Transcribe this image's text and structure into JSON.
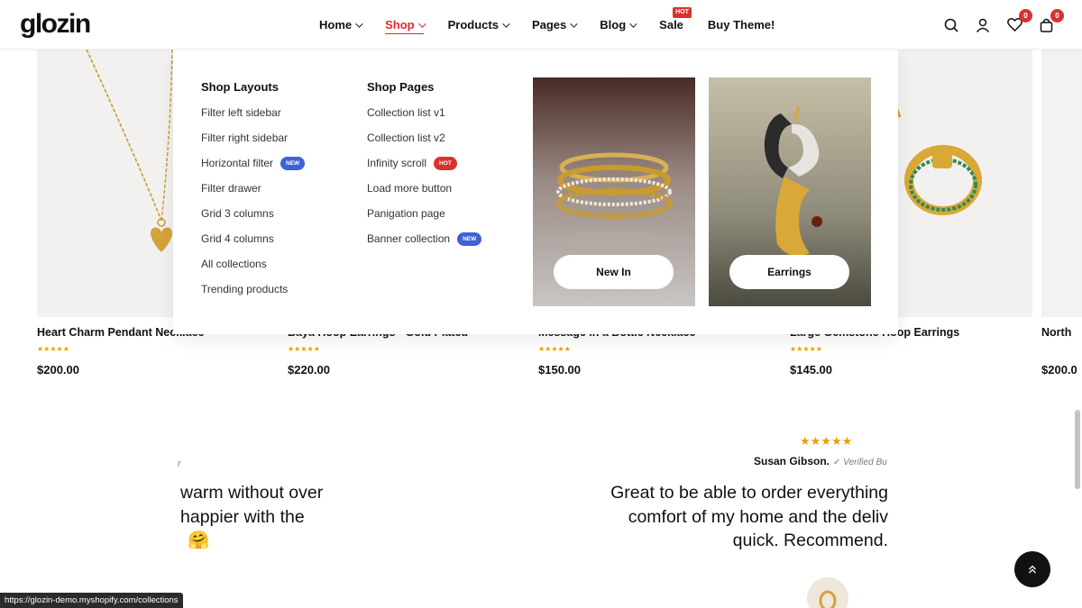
{
  "brand": {
    "logo": "glozin"
  },
  "nav": {
    "items": [
      {
        "label": "Home"
      },
      {
        "label": "Shop"
      },
      {
        "label": "Products"
      },
      {
        "label": "Pages"
      },
      {
        "label": "Blog"
      },
      {
        "label": "Sale",
        "badge": "HOT"
      },
      {
        "label": "Buy Theme!"
      }
    ]
  },
  "header_icons": {
    "search": "search-icon",
    "account": "user-icon",
    "wishlist": {
      "icon": "heart-icon",
      "count": "0"
    },
    "cart": {
      "icon": "cart-icon",
      "count": "0"
    }
  },
  "mega_menu": {
    "layouts": {
      "heading": "Shop Layouts",
      "links": [
        {
          "label": "Filter left sidebar"
        },
        {
          "label": "Filter right sidebar"
        },
        {
          "label": "Horizontal filter",
          "tag": "NEW"
        },
        {
          "label": "Filter drawer"
        },
        {
          "label": "Grid 3 columns"
        },
        {
          "label": "Grid 4 columns"
        },
        {
          "label": "All collections"
        },
        {
          "label": "Trending products"
        }
      ]
    },
    "pages": {
      "heading": "Shop Pages",
      "links": [
        {
          "label": "Collection list v1"
        },
        {
          "label": "Collection list v2"
        },
        {
          "label": "Infinity scroll",
          "tag": "HOT"
        },
        {
          "label": "Load more button"
        },
        {
          "label": "Panigation page"
        },
        {
          "label": "Banner collection",
          "tag": "NEW"
        }
      ]
    },
    "promos": [
      {
        "button": "New In"
      },
      {
        "button": "Earrings"
      }
    ]
  },
  "products": [
    {
      "name": "Heart Charm Pendant Necklace",
      "price": "$200.00",
      "rating": "★★★★★"
    },
    {
      "name": "Baya Hoop Earrings - Gold Plated",
      "price": "$220.00",
      "rating": "★★★★★"
    },
    {
      "name": "Message in a Bottle Necklace",
      "price": "$150.00",
      "rating": "★★★★★"
    },
    {
      "name": "Large Gemstone Hoop Earrings",
      "price": "$145.00",
      "rating": "★★★★★"
    },
    {
      "name": "North",
      "price": "$200.0",
      "rating": ""
    }
  ],
  "testimonials": {
    "left": {
      "author_fragment": "r",
      "lines": [
        "warm without over",
        "happier with the",
        "🤗"
      ]
    },
    "right": {
      "rating": "★★★★★",
      "author": "Susan Gibson.",
      "verified": "✓ Verified Bu",
      "lines": [
        "Great to be able to order everything",
        "comfort of my home and the deliv",
        "quick. Recommend."
      ]
    }
  },
  "status_url": "https://glozin-demo.myshopify.com/collections",
  "colors": {
    "accent": "#e02a2a",
    "star": "#e8a100",
    "tag_new": "#3e62d8",
    "tag_hot": "#d9322e"
  }
}
